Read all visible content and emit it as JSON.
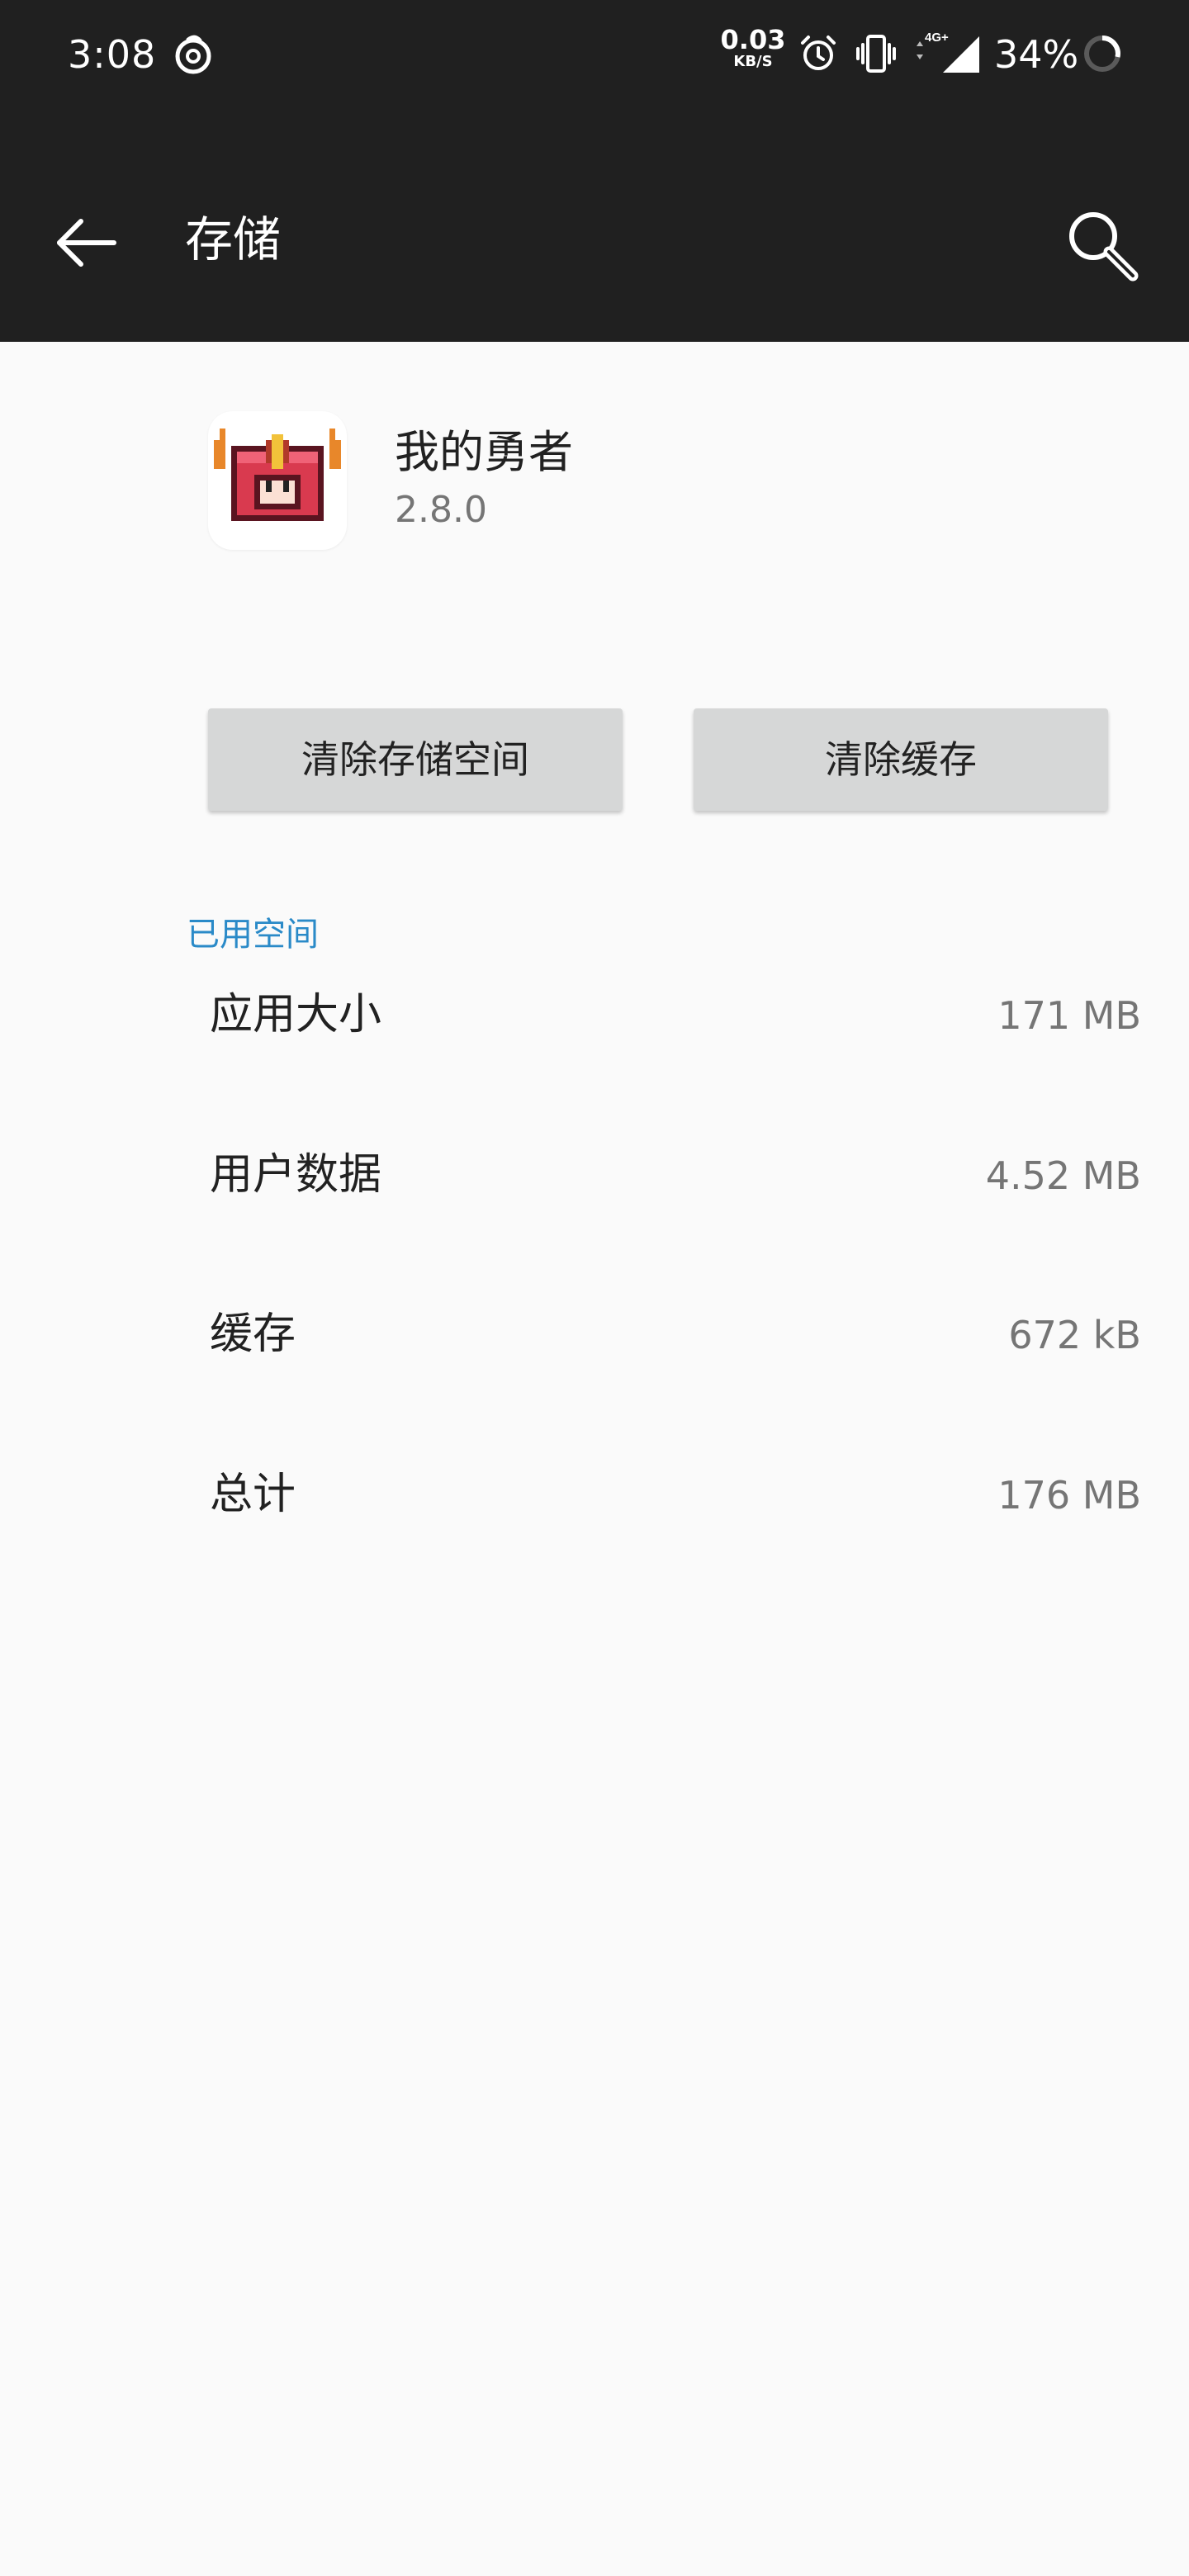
{
  "status_bar": {
    "time": "3:08",
    "net_speed_value": "0.03",
    "net_speed_unit": "KB/S",
    "network_type": "4G+",
    "battery": "34%",
    "icons": [
      "netease-music-icon",
      "alarm-icon",
      "vibrate-icon",
      "signal-icon",
      "battery-icon"
    ]
  },
  "toolbar": {
    "title": "存储",
    "back_icon": "back-arrow-icon",
    "search_icon": "search-icon"
  },
  "app": {
    "name": "我的勇者",
    "version": "2.8.0"
  },
  "buttons": {
    "clear_storage": "清除存储空间",
    "clear_cache": "清除缓存"
  },
  "section": {
    "header": "已用空间",
    "rows": [
      {
        "label": "应用大小",
        "value": "171 MB"
      },
      {
        "label": "用户数据",
        "value": "4.52 MB"
      },
      {
        "label": "缓存",
        "value": "672 kB"
      },
      {
        "label": "总计",
        "value": "176 MB"
      }
    ]
  },
  "colors": {
    "status_bar_bg": "#202020",
    "toolbar_bg": "#202020",
    "page_bg": "#fafafa",
    "accent": "#2a8ac8",
    "button_bg": "#d6d7d7",
    "app_icon_red": "#d93a4f"
  }
}
